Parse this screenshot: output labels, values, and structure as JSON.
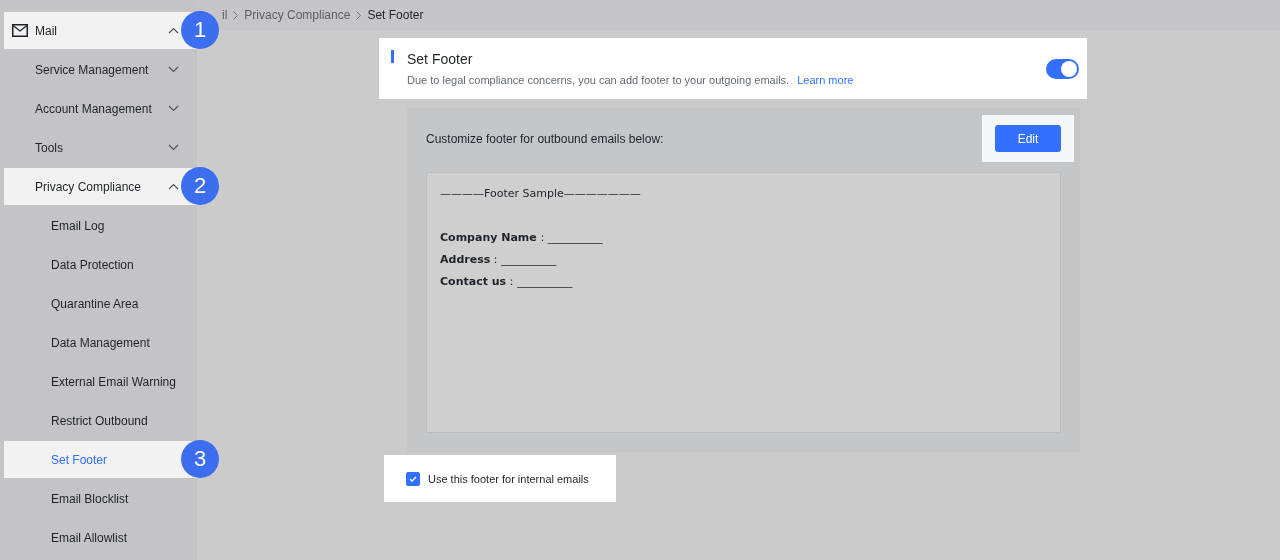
{
  "breadcrumb": [
    "il",
    "Privacy Compliance",
    "Set Footer"
  ],
  "sidebar": {
    "items": [
      {
        "label": "Mail",
        "kind": "root",
        "expanded": true,
        "selected": false,
        "spotlight": true,
        "callout": "1",
        "children": [
          {
            "label": "Service Management",
            "kind": "group",
            "expanded": false,
            "selected": false,
            "spotlight": false
          },
          {
            "label": "Account Management",
            "kind": "group",
            "expanded": false,
            "selected": false,
            "spotlight": false
          },
          {
            "label": "Tools",
            "kind": "group",
            "expanded": false,
            "selected": false,
            "spotlight": false
          },
          {
            "label": "Privacy Compliance",
            "kind": "group",
            "expanded": true,
            "selected": false,
            "spotlight": true,
            "callout": "2",
            "children": [
              {
                "label": "Email Log",
                "kind": "leaf",
                "selected": false,
                "spotlight": false
              },
              {
                "label": "Data Protection",
                "kind": "leaf",
                "selected": false,
                "spotlight": false
              },
              {
                "label": "Quarantine Area",
                "kind": "leaf",
                "selected": false,
                "spotlight": false
              },
              {
                "label": "Data Management",
                "kind": "leaf",
                "selected": false,
                "spotlight": false
              },
              {
                "label": "External Email Warning",
                "kind": "leaf",
                "selected": false,
                "spotlight": false
              },
              {
                "label": "Restrict Outbound",
                "kind": "leaf",
                "selected": false,
                "spotlight": false
              },
              {
                "label": "Set Footer",
                "kind": "leaf",
                "selected": true,
                "spotlight": true,
                "callout": "3"
              },
              {
                "label": "Email Blocklist",
                "kind": "leaf",
                "selected": false,
                "spotlight": false
              },
              {
                "label": "Email Allowlist",
                "kind": "leaf",
                "selected": false,
                "spotlight": false
              }
            ]
          }
        ]
      }
    ]
  },
  "header": {
    "title": "Set Footer",
    "description": "Due to legal compliance concerns, you can add footer to your outgoing emails.",
    "link": "Learn more",
    "toggle": {
      "on": true
    },
    "spotlight": true
  },
  "footer_panel": {
    "prompt": "Customize footer for outbound emails below:",
    "edit_button": {
      "label": "Edit",
      "spotlight": true
    },
    "sample": {
      "heading": "————Footer Sample———————",
      "lines": [
        "**Company Name**：__________",
        "**Address**：__________",
        "**Contact us**：__________"
      ]
    }
  },
  "internal_option": {
    "label": "Use this footer for internal emails",
    "checked": true,
    "spotlight": true
  }
}
